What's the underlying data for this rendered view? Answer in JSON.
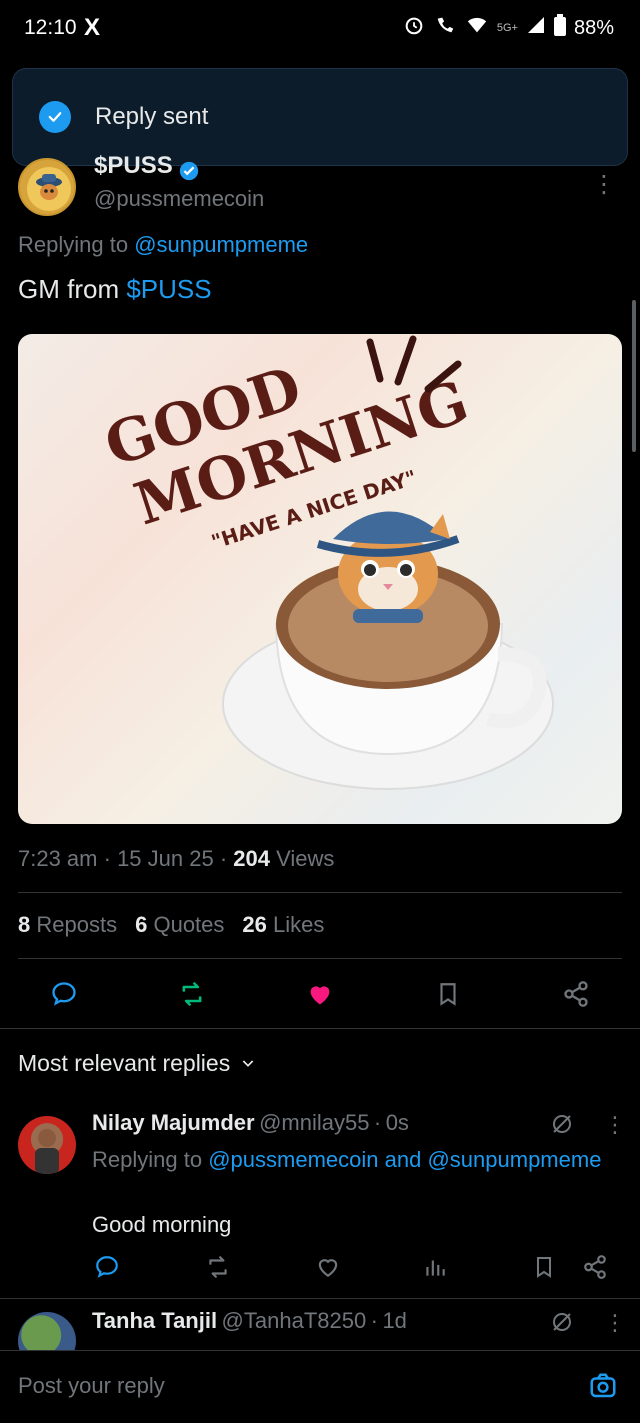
{
  "status_bar": {
    "time": "12:10",
    "x_logo": "X",
    "network": "5G+",
    "battery": "88%"
  },
  "toast": {
    "message": "Reply sent"
  },
  "tweet": {
    "author_name": "$PUSS",
    "author_handle": "@pussmemecoin",
    "replying_prefix": "Replying to",
    "replying_to": "@sunpumpmeme",
    "text_prefix": "GM from",
    "text_cashtag": "$PUSS",
    "image_text": {
      "line1": "GOOD",
      "line2": "MORNING",
      "line3": "\"HAVE A NICE DAY\""
    },
    "time": "7:23 am",
    "date": "15 Jun 25",
    "views_count": "204",
    "views_label": "Views",
    "reposts_count": "8",
    "reposts_label": "Reposts",
    "quotes_count": "6",
    "quotes_label": "Quotes",
    "likes_count": "26",
    "likes_label": "Likes"
  },
  "replies_header": {
    "label": "Most relevant replies"
  },
  "replies": [
    {
      "name": "Nilay Majumder",
      "handle": "@mnilay55",
      "time": "0s",
      "replying_prefix": "Replying to",
      "replying_to_1": "@pussmemecoin",
      "replying_and": "and",
      "replying_to_2": "@sunpumpmeme",
      "text": "Good morning"
    },
    {
      "name": "Tanha Tanjil",
      "handle": "@TanhaT8250",
      "time": "1d"
    }
  ],
  "composer": {
    "placeholder": "Post your reply"
  },
  "colors": {
    "accent": "#1d9bf0",
    "like": "#f91880",
    "repost": "#00ba7c",
    "background": "#000000"
  },
  "icons": [
    "x-logo-icon",
    "alarm-icon",
    "wifi-call-icon",
    "signal-icon",
    "battery-icon",
    "check-icon",
    "verified-badge-icon",
    "more-icon",
    "reply-icon",
    "repost-icon",
    "like-icon",
    "bookmark-icon",
    "share-icon",
    "chevron-down-icon",
    "grok-icon",
    "views-icon",
    "camera-icon"
  ]
}
